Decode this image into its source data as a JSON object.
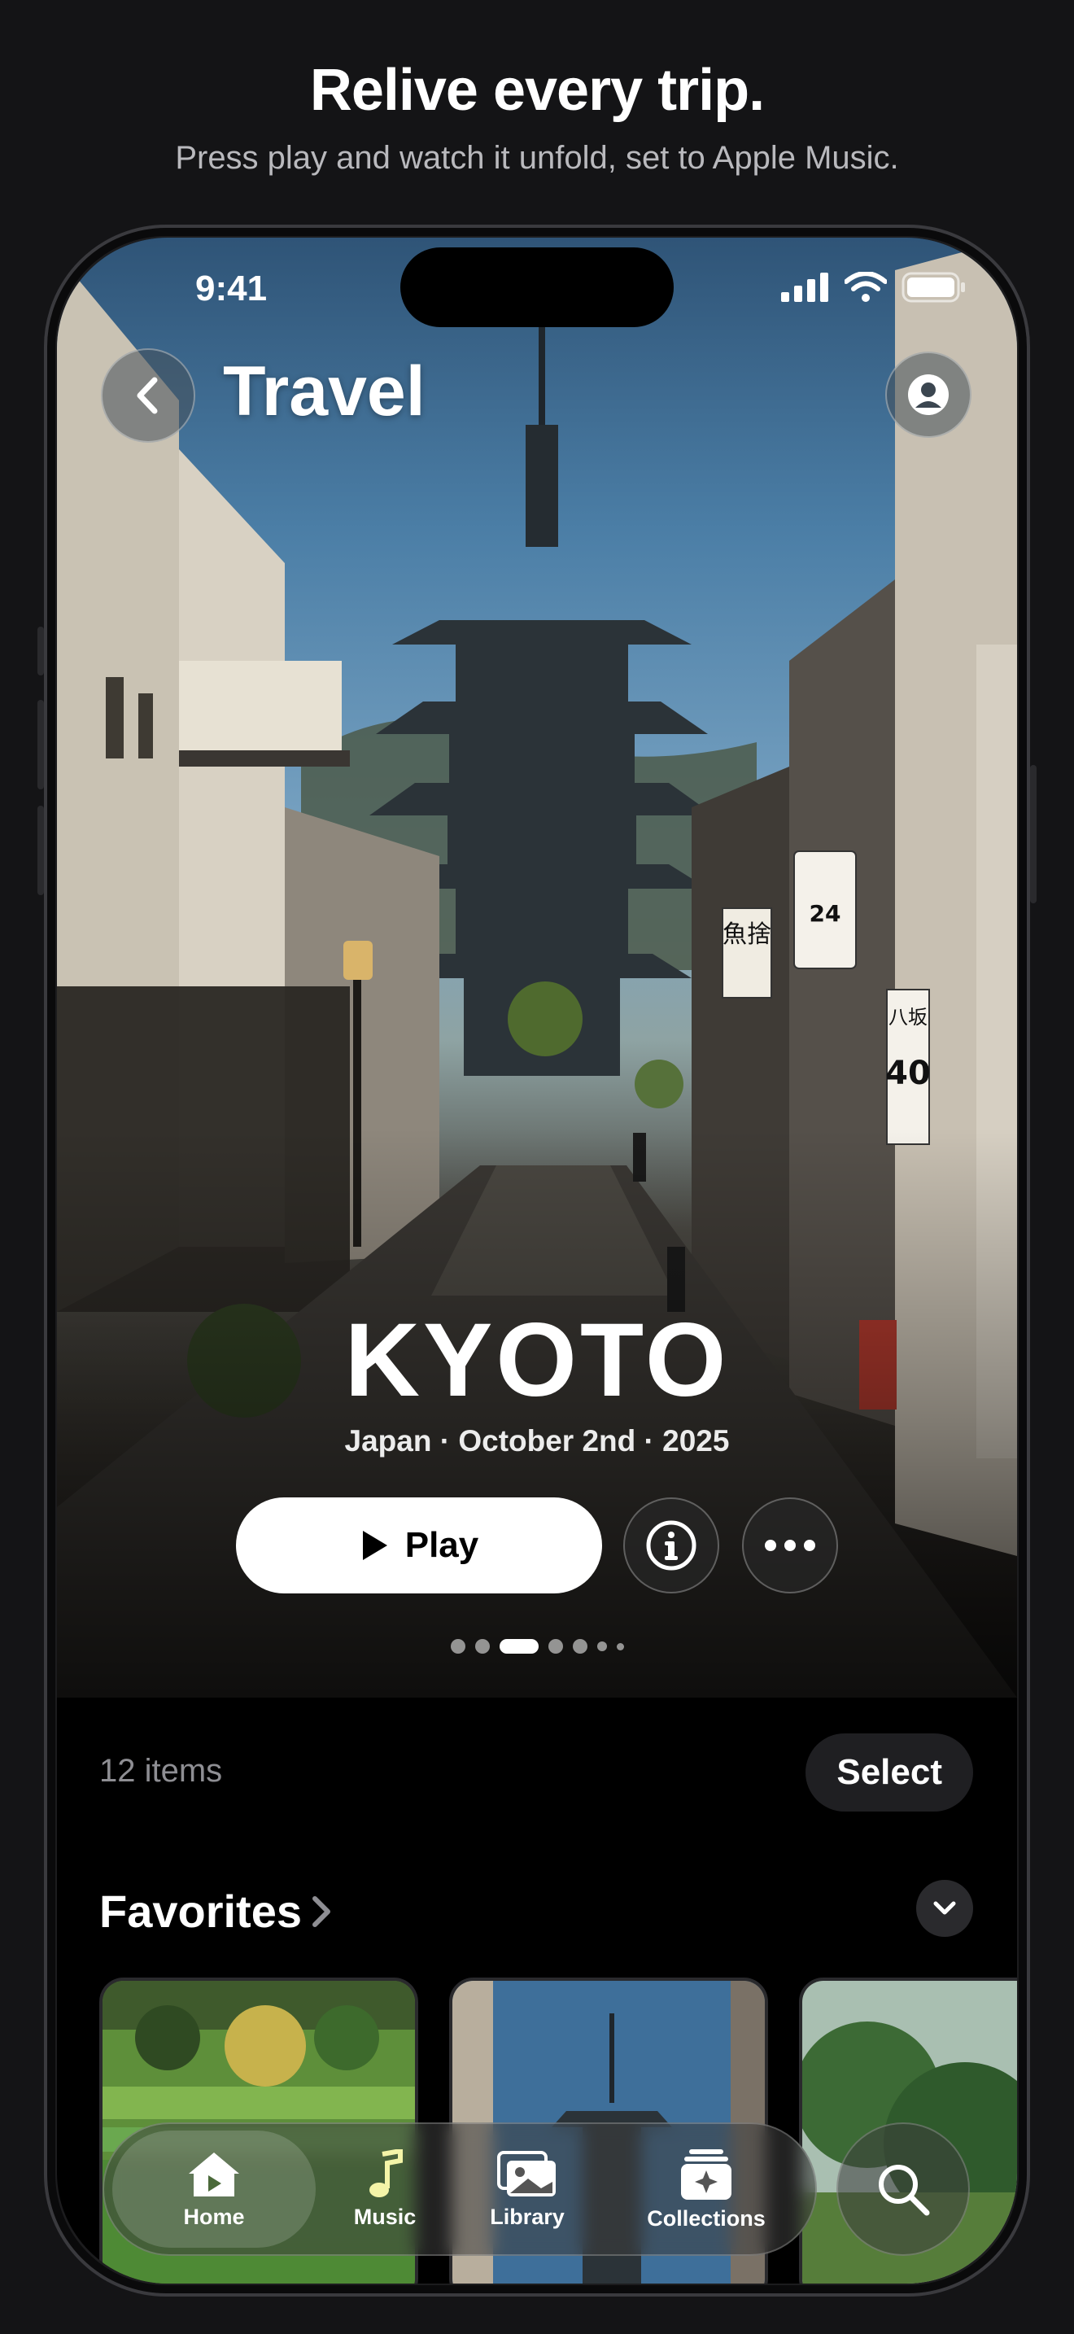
{
  "marketing": {
    "title": "Relive every trip.",
    "subtitle": "Press play and watch it unfold, set to Apple Music."
  },
  "status_bar": {
    "time": "9:41",
    "icons": [
      "cellular-signal-icon",
      "wifi-icon",
      "battery-icon"
    ]
  },
  "header": {
    "back_icon": "chevron-left-icon",
    "title": "Travel",
    "profile_icon": "person-circle-icon"
  },
  "hero": {
    "title": "KYOTO",
    "meta": "Japan · October 2nd · 2025",
    "play_label": "Play",
    "info_icon": "info-icon",
    "more_icon": "ellipsis-icon",
    "page_count": 7,
    "active_page_index": 2,
    "signs": {
      "sign_a": "魚捨",
      "parking": "24",
      "sign_b": "八坂",
      "sign_b_number": "40"
    }
  },
  "library": {
    "items_count": "12 items",
    "select_label": "Select"
  },
  "favorites": {
    "title": "Favorites",
    "thumbnails": [
      "rice-terraces-photo",
      "pagoda-street-photo",
      "jungle-photo"
    ]
  },
  "tab_bar": {
    "tabs": [
      {
        "label": "Home",
        "icon": "home-icon",
        "active": true
      },
      {
        "label": "Music",
        "icon": "music-note-icon",
        "active": false
      },
      {
        "label": "Library",
        "icon": "photos-icon",
        "active": false
      },
      {
        "label": "Collections",
        "icon": "collections-icon",
        "active": false
      }
    ],
    "search_icon": "search-icon"
  },
  "colors": {
    "background": "#141416",
    "screen_background": "#000000",
    "button_fill": "#ffffff",
    "secondary_text": "#8e8e93",
    "accent_green": "#6aa84f"
  }
}
